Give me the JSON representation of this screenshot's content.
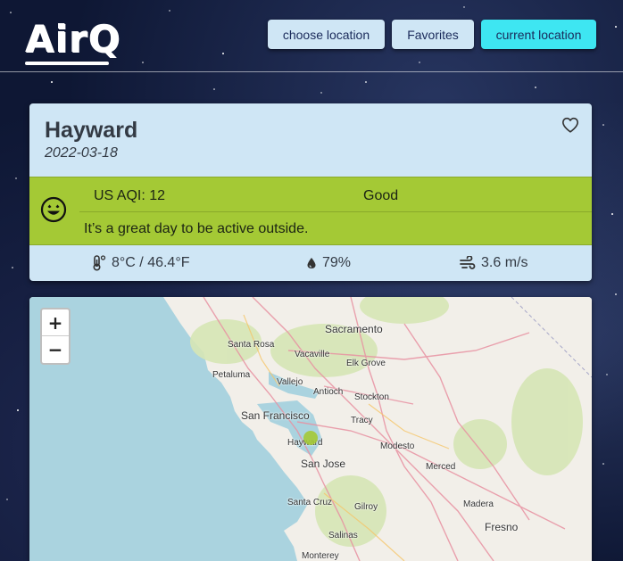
{
  "app": {
    "logo": "AirQ"
  },
  "nav": {
    "choose_location": "choose location",
    "favorites": "Favorites",
    "current_location": "current location"
  },
  "location": {
    "city": "Hayward",
    "date": "2022-03-18"
  },
  "aqi": {
    "value_label": "US AQI: 12",
    "category": "Good",
    "message": "It’s a great day to be active outside.",
    "color": "#a4c935"
  },
  "weather": {
    "temperature": "8°C / 46.4°F",
    "humidity": "79%",
    "wind": "3.6 m/s"
  },
  "map": {
    "zoom_in": "+",
    "zoom_out": "−",
    "places": {
      "sacramento": "Sacramento",
      "santa_rosa": "Santa Rosa",
      "vacaville": "Vacaville",
      "elk_grove": "Elk Grove",
      "petaluma": "Petaluma",
      "vallejo": "Vallejo",
      "antioch": "Antioch",
      "stockton": "Stockton",
      "san_francisco": "San Francisco",
      "tracy": "Tracy",
      "hayward": "Hayward",
      "modesto": "Modesto",
      "san_jose": "San Jose",
      "merced": "Merced",
      "santa_cruz": "Santa Cruz",
      "gilroy": "Gilroy",
      "madera": "Madera",
      "fresno": "Fresno",
      "salinas": "Salinas",
      "monterey": "Monterey"
    }
  }
}
